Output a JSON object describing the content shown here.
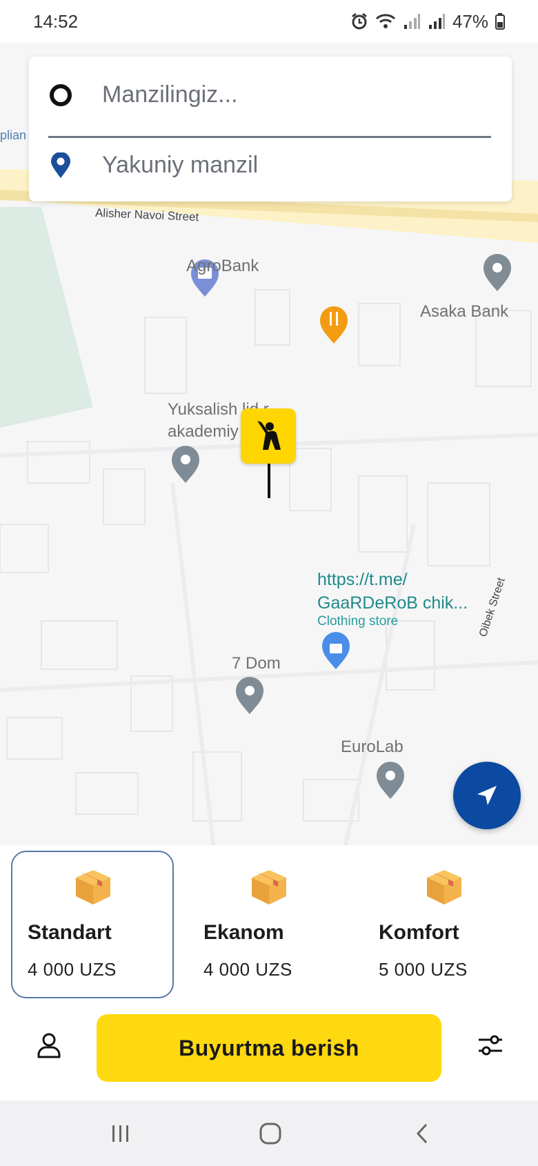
{
  "status_bar": {
    "time": "14:52",
    "battery": "47%"
  },
  "search": {
    "from_placeholder": "Manzilingiz...",
    "to_placeholder": "Yakuniy manzil"
  },
  "map": {
    "streets": {
      "alisher_navoi": "Alisher Navoi Street",
      "oibek": "Oibek Street"
    },
    "partial_label": "plian",
    "places": {
      "agrobank": "AgroBank",
      "asaka": "Asaka Bank",
      "yuksalish_line1": "Yuksalish lid r",
      "yuksalish_line2": "akademiy  g'ona...",
      "tme_line1": "https://t.me/",
      "tme_line2": "GaaRDeRoB chik...",
      "tme_category": "Clothing store",
      "dom": "7 Dom",
      "eurolab": "EuroLab"
    }
  },
  "tariffs": [
    {
      "name": "Standart",
      "price": "4 000 UZS",
      "selected": true
    },
    {
      "name": "Ekanom",
      "price": "4 000 UZS",
      "selected": false
    },
    {
      "name": "Komfort",
      "price": "5 000 UZS",
      "selected": false
    }
  ],
  "actions": {
    "order_label": "Buyurtma berish"
  },
  "icons": {
    "from": "origin-circle-icon",
    "to": "destination-pin-icon",
    "center": "passenger-hail-icon",
    "locate": "navigation-arrow-icon",
    "profile": "person-icon",
    "filter": "sliders-icon"
  },
  "colors": {
    "accent": "#ffd90f",
    "primary_blue": "#0b4aa0",
    "selected_border": "#5a79a6"
  }
}
